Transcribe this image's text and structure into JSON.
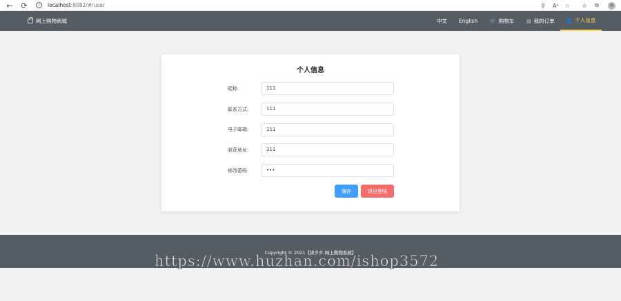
{
  "browser": {
    "back": "←",
    "reload": "⟳",
    "info": "i",
    "url_host": "localhost",
    "url_path": ":8082/#/user",
    "tools": [
      "⚲",
      "Aᵃ",
      "☆",
      "✩",
      "⧉"
    ]
  },
  "header": {
    "brand": "网上购物商城",
    "menu": {
      "chinese": "中文",
      "english": "English",
      "cart": "购物车",
      "orders": "我的订单",
      "profile": "个人信息"
    },
    "icons": {
      "cart": "🛒",
      "orders": "▤",
      "profile": "👤"
    },
    "active_color": "#ffd04b",
    "bg_color": "#545c64"
  },
  "form": {
    "title": "个人信息",
    "fields": [
      {
        "label": "昵称:",
        "value": "111"
      },
      {
        "label": "联系方式:",
        "value": "111"
      },
      {
        "label": "电子邮箱:",
        "value": "111"
      },
      {
        "label": "收获地址:",
        "value": "111"
      },
      {
        "label": "修改密码:",
        "value": "•••"
      }
    ],
    "save_label": "保存",
    "logout_label": "退出登陆",
    "save_color": "#409eff",
    "logout_color": "#f56c6c"
  },
  "footer": {
    "copyright": "Copyright © 2021【拼夕夕-网上购物系统】"
  },
  "watermark": "https://www.huzhan.com/ishop3572"
}
